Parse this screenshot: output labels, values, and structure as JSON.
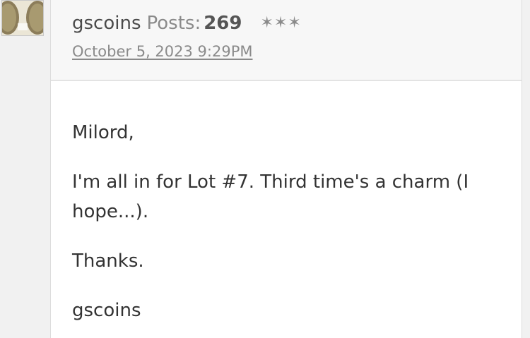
{
  "author": {
    "username": "gscoins",
    "posts_label": "Posts:",
    "posts_count": "269",
    "rank_stars": "✶✶✶",
    "date": "October 5, 2023 9:29PM"
  },
  "body": {
    "paragraphs": [
      "Milord,",
      "I'm all in for Lot #7. Third time's a charm (I hope...).",
      "Thanks.",
      "gscoins"
    ]
  }
}
